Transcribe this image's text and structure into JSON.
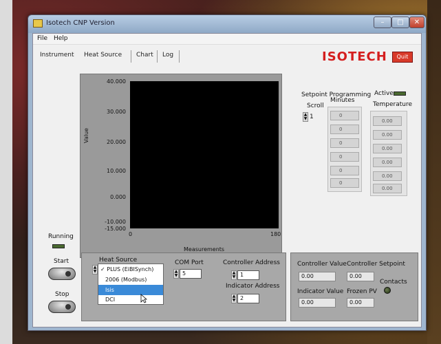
{
  "window": {
    "title": "Isotech CNP Version",
    "minimize": "–",
    "maximize": "□",
    "close": "✕"
  },
  "menu": {
    "file": "File",
    "help": "Help"
  },
  "tabs": [
    {
      "label": "Instrument"
    },
    {
      "label": "Heat Source"
    },
    {
      "label": "Chart"
    },
    {
      "label": "Log"
    }
  ],
  "brand": {
    "logo": "ISOTECH",
    "quit": "Quit",
    "color": "#d41e1e"
  },
  "chart_data": {
    "type": "line",
    "ylabel": "Value",
    "xlabel": "Measurements",
    "y_ticks": [
      "40.000",
      "30.000",
      "20.000",
      "10.000",
      "0.000",
      "-10.000",
      "-15.000"
    ],
    "x_ticks": [
      "0",
      "180"
    ],
    "ylim": [
      -15,
      40
    ],
    "xlim": [
      0,
      180
    ],
    "series": [],
    "background": "#000000"
  },
  "status": {
    "running_label": "Running",
    "start_label": "Start",
    "stop_label": "Stop"
  },
  "setpoint": {
    "title": "Setpoint Programming",
    "active_label": "Active",
    "scroll_label": "Scroll",
    "scroll_value": "1",
    "minutes_label": "Minutes",
    "temperature_label": "Temperature",
    "minutes": [
      "0",
      "0",
      "0",
      "0",
      "0",
      "0"
    ],
    "temperatures": [
      "0.00",
      "0.00",
      "0.00",
      "0.00",
      "0.00",
      "0.00"
    ]
  },
  "heat_source": {
    "label": "Heat Source",
    "options": [
      "PLUS (EiBISynch)",
      "2006 (Modbus)",
      "Isis",
      "DCI"
    ],
    "checked_option": "PLUS (EiBISynch)",
    "check": "✓",
    "highlighted_option": "Isis"
  },
  "com": {
    "com_port_label": "COM Port",
    "com_port_value": "5",
    "controller_address_label": "Controller Address",
    "controller_address_value": "1",
    "indicator_address_label": "Indicator Address",
    "indicator_address_value": "2"
  },
  "readouts": {
    "controller_value_label": "Controller Value",
    "controller_value": "0.00",
    "controller_setpoint_label": "Controller Setpoint",
    "controller_setpoint": "0.00",
    "indicator_value_label": "Indicator Value",
    "indicator_value": "0.00",
    "frozen_pv_label": "Frozen PV",
    "frozen_pv": "0.00",
    "contacts_label": "Contacts"
  }
}
